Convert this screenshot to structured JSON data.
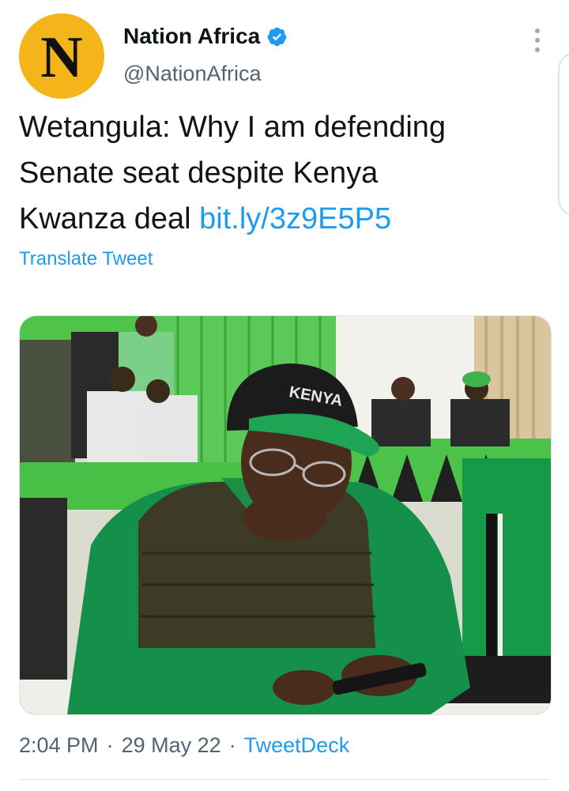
{
  "tweet": {
    "avatar_letter": "N",
    "display_name": "Nation Africa",
    "handle": "@NationAfrica",
    "text_line1": "Wetangula: Why I am defending",
    "text_line2": "Senate seat despite Kenya",
    "text_line3": "Kwanza deal ",
    "link": "bit.ly/3z9E5P5",
    "translate_label": "Translate Tweet",
    "photo_cap_text": "KENYA",
    "time": "2:04 PM",
    "date": "29 May 22",
    "source": "TweetDeck",
    "separator": "·"
  },
  "colors": {
    "link_blue": "#1d9bf0",
    "secondary_text": "#536471",
    "avatar_yellow": "#f3b519"
  },
  "icons": {
    "verified": "verified-badge-icon",
    "more": "more-options-icon"
  }
}
